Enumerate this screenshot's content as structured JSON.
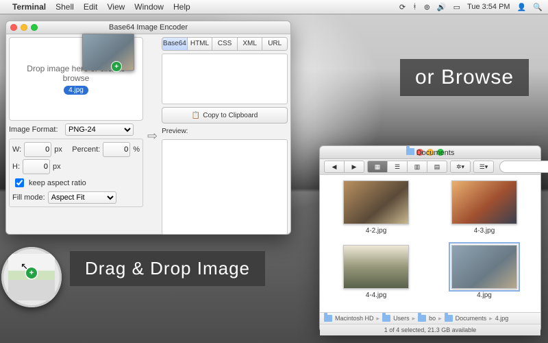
{
  "menubar": {
    "app": "Terminal",
    "items": [
      "Shell",
      "Edit",
      "View",
      "Window",
      "Help"
    ],
    "right": {
      "time": "Tue 3:54 PM"
    }
  },
  "encoder": {
    "title": "Base64 Image Encoder",
    "drop_text_l1": "Drop image here or click to",
    "drop_text_l2": "browse",
    "drop_tag": "4.jpg",
    "image_format_label": "Image Format:",
    "image_format_value": "PNG-24",
    "w_label": "W:",
    "w_value": "0",
    "w_unit": "px",
    "h_label": "H:",
    "h_value": "0",
    "h_unit": "px",
    "percent_label": "Percent:",
    "percent_value": "0",
    "percent_unit": "%",
    "keep_aspect_label": "keep aspect ratio",
    "fill_mode_label": "Fill mode:",
    "fill_mode_value": "Aspect Fit",
    "tabs": [
      "Base64",
      "HTML",
      "CSS",
      "XML",
      "URL"
    ],
    "active_tab": 0,
    "copy_label": "Copy to Clipboard",
    "preview_label": "Preview:"
  },
  "finder": {
    "title": "Documents",
    "files": [
      {
        "name": "4-2.jpg",
        "bg": "linear-gradient(140deg,#b89060,#5a4a38 60%,#c9b890)"
      },
      {
        "name": "4-3.jpg",
        "bg": "linear-gradient(140deg,#e9b070,#a05030 55%,#3a4050)"
      },
      {
        "name": "4-4.jpg",
        "bg": "linear-gradient(180deg,#ece7d6,#97987b 50%,#59614a)"
      },
      {
        "name": "4.jpg",
        "bg": "linear-gradient(140deg,#8fa4b3,#6a7a85 60%,#b7a88d)",
        "selected": true
      }
    ],
    "path": [
      "Macintosh HD",
      "Users",
      "bo",
      "Documents",
      "4.jpg"
    ],
    "status": "1 of 4 selected, 21.3 GB available",
    "search_placeholder": ""
  },
  "promo": {
    "drag": "Drag & Drop Image",
    "browse": "or Browse"
  }
}
